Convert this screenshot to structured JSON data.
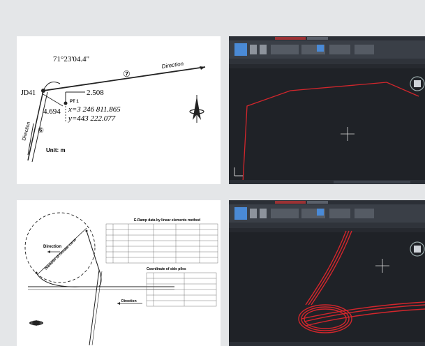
{
  "diagram1": {
    "angle": "71°23'04.4\"",
    "circle7": "⑦",
    "direction_top": "Direction",
    "jd": "JD41",
    "offset": "2.508",
    "pt": "PT 1",
    "x": "x=3 246 811.865",
    "y": "y=443 222.077",
    "dist": "4.694",
    "circle6": "⑥",
    "direction_left": "Direction",
    "unit": "Unit: m"
  },
  "diagram2": {
    "table_title": "E-Ramp data by linear elements method",
    "side_title": "Coordinate of side piles",
    "direction_a": "Direction",
    "direction_b": "Direction",
    "curve_label": "Diameter of circular curve"
  },
  "colors": {
    "cad_bg": "#1f2227",
    "cad_ribbon": "#3a3f47",
    "cad_title": "#2b2f36",
    "polyline": "#d2262c",
    "accent": "#4a8ad6"
  }
}
